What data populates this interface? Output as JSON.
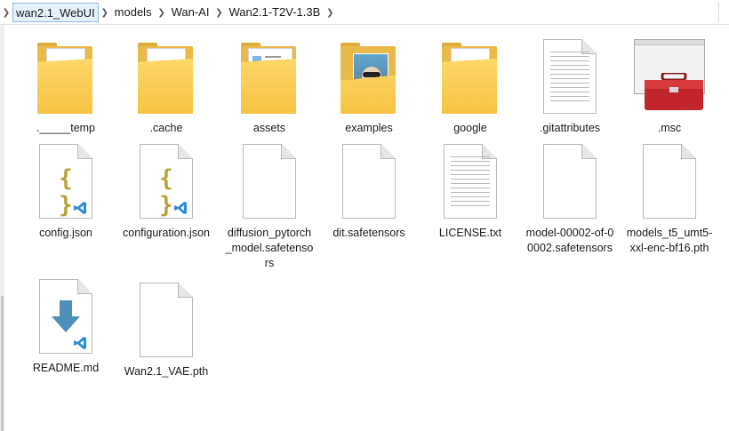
{
  "address": {
    "crumbs": [
      "wan2.1_WebUI",
      "models",
      "Wan-AI",
      "Wan2.1-T2V-1.3B"
    ]
  },
  "items": [
    {
      "name": "._____temp",
      "kind": "folder"
    },
    {
      "name": ".cache",
      "kind": "folder"
    },
    {
      "name": "assets",
      "kind": "folder"
    },
    {
      "name": "examples",
      "kind": "folder"
    },
    {
      "name": "google",
      "kind": "folder"
    },
    {
      "name": ".gitattributes",
      "kind": "text-file"
    },
    {
      "name": ".msc",
      "kind": "msc-file"
    },
    {
      "name": "config.json",
      "kind": "json-file"
    },
    {
      "name": "configuration.json",
      "kind": "json-file"
    },
    {
      "name": "diffusion_pytorch_model.safetensors",
      "kind": "blank-file"
    },
    {
      "name": "dit.safetensors",
      "kind": "blank-file"
    },
    {
      "name": "LICENSE.txt",
      "kind": "text-file"
    },
    {
      "name": "model-00002-of-00002.safetensors",
      "kind": "blank-file"
    },
    {
      "name": "models_t5_umt5-xxl-enc-bf16.pth",
      "kind": "blank-file"
    },
    {
      "name": "README.md",
      "kind": "markdown-file"
    },
    {
      "name": "Wan2.1_VAE.pth",
      "kind": "blank-file"
    }
  ],
  "colors": {
    "folder": "#f6c343",
    "selection_border": "#8fb9e6",
    "vscode_blue": "#2c8ed6",
    "json_brace": "#b9a235"
  }
}
